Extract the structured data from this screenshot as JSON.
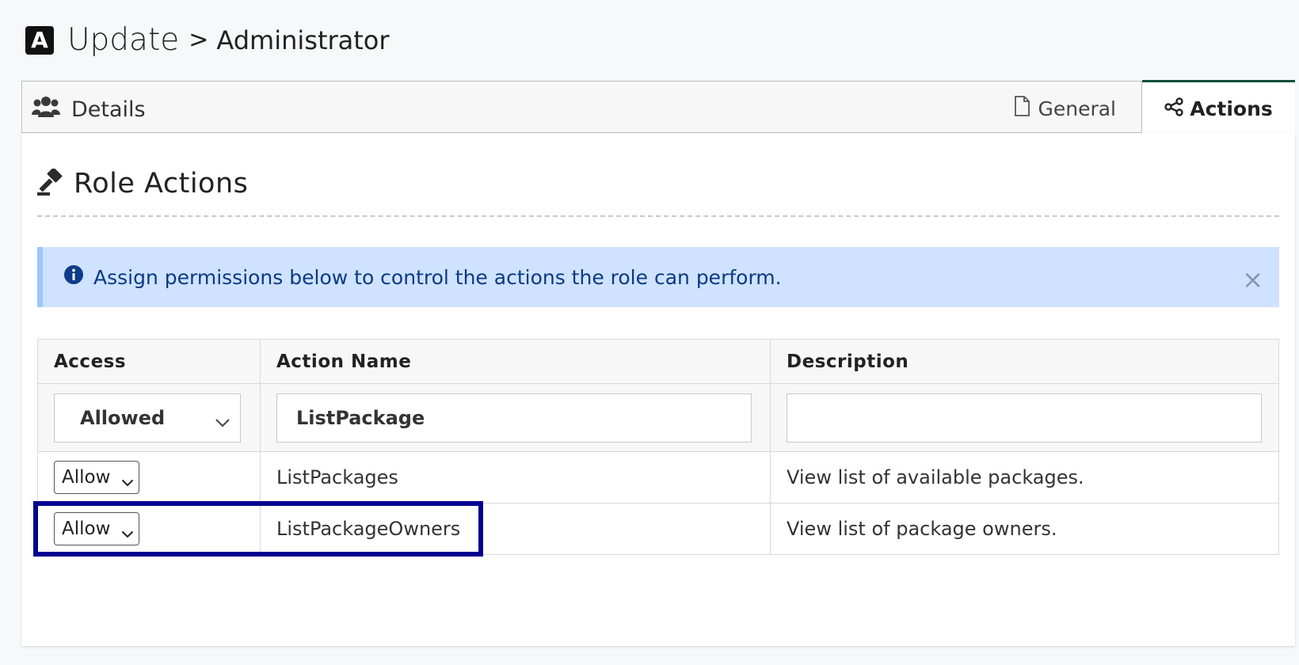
{
  "header": {
    "logo_letter": "A",
    "title": "Update",
    "separator": ">",
    "breadcrumb": "Administrator"
  },
  "tabs": {
    "details_label": "Details",
    "general_label": "General",
    "actions_label": "Actions",
    "active": "Actions"
  },
  "section": {
    "title": "Role Actions"
  },
  "alert": {
    "message": "Assign permissions below to control the actions the role can perform.",
    "close_glyph": "×"
  },
  "table": {
    "headers": {
      "access": "Access",
      "action_name": "Action Name",
      "description": "Description"
    },
    "filter": {
      "access_value": "Allowed",
      "action_name_value": "ListPackage",
      "description_value": ""
    },
    "rows": [
      {
        "access": "Allow",
        "action_name": "ListPackages",
        "description": "View list of available packages."
      },
      {
        "access": "Allow",
        "action_name": "ListPackageOwners",
        "description": "View list of package owners."
      }
    ]
  },
  "colors": {
    "active_tab_border": "#0f4f3f",
    "alert_bg": "#cfe2ff",
    "alert_text": "#0a3a84",
    "highlight_border": "#000090"
  }
}
